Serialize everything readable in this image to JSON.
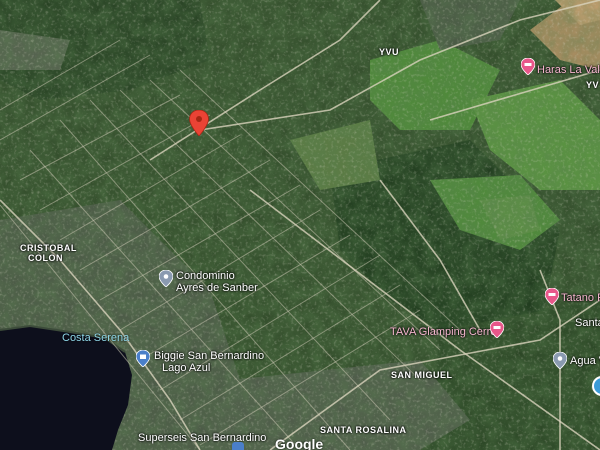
{
  "map": {
    "provider_logo": "Google",
    "area_labels": {
      "yvu": "YVU",
      "yvu_right": "YV",
      "cristobal": "CRISTOBAL",
      "colon": "COLON",
      "san_miguel": "SAN MIGUEL",
      "santa_rosalina": "SANTA ROSALINA",
      "santa": "Santa"
    },
    "water_labels": {
      "costa_serena": "Costa Serena"
    },
    "poi": {
      "haras": "Haras La Valte",
      "condominio_line1": "Condominio",
      "condominio_line2": "Ayres de Sanber",
      "tatano": "Tatano F",
      "tava": "TAVA Glamping Cerro",
      "biggie_line1": "Biggie San Bernardino",
      "biggie_line2": "Lago Azul",
      "agua": "Agua V",
      "superseis": "Superseis San Bernardino"
    },
    "icons": [
      "location-pin-icon",
      "hotel-icon",
      "store-icon",
      "place-icon"
    ],
    "colors": {
      "pin": "#ea4335",
      "hotel_marker": "#e8578a",
      "store_marker": "#4a7fc9",
      "place_marker": "#8a9ab0"
    }
  }
}
